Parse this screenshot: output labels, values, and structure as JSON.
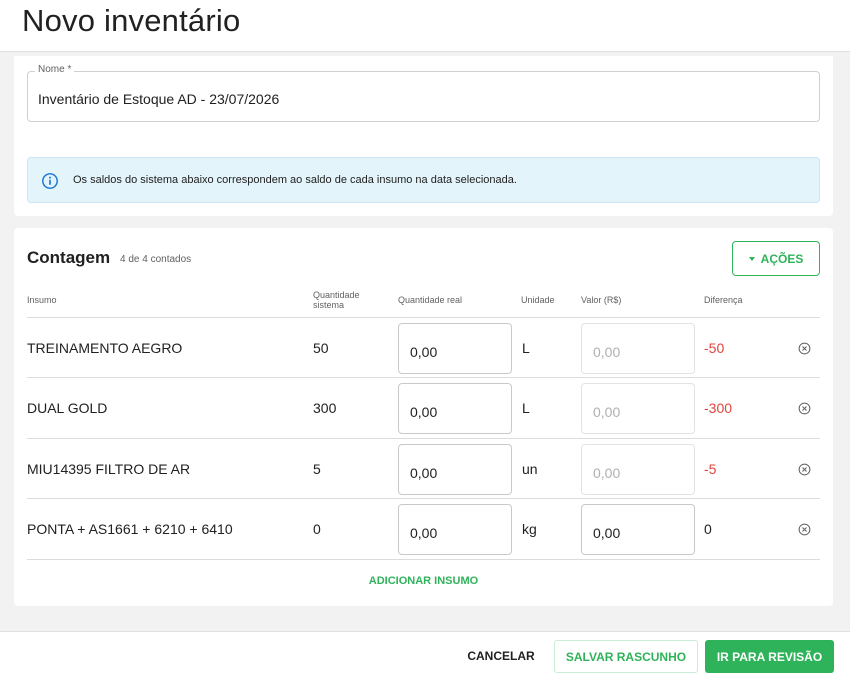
{
  "page": {
    "title": "Novo inventário"
  },
  "name_field": {
    "label": "Nome *",
    "value": "Inventário de Estoque AD - 23/07/2026"
  },
  "info": {
    "icon": "info-icon",
    "text": "Os saldos do sistema abaixo correspondem ao saldo de cada insumo na data selecionada."
  },
  "count": {
    "title": "Contagem",
    "subtitle": "4 de 4 contados",
    "actions_label": "AÇÕES",
    "columns": {
      "insumo": "Insumo",
      "qty_system_1": "Quantidade",
      "qty_system_2": "sistema",
      "qty_real": "Quantidade real",
      "unit": "Unidade",
      "value": "Valor (R$)",
      "diff": "Diferença"
    },
    "rows": [
      {
        "name": "TREINAMENTO AEGRO",
        "qty_system": "50",
        "qty_real": "0,00",
        "unit": "L",
        "value": "0,00",
        "value_enabled": false,
        "diff": "-50"
      },
      {
        "name": "DUAL GOLD",
        "qty_system": "300",
        "qty_real": "0,00",
        "unit": "L",
        "value": "0,00",
        "value_enabled": false,
        "diff": "-300"
      },
      {
        "name": "MIU14395 FILTRO DE AR",
        "qty_system": "5",
        "qty_real": "0,00",
        "unit": "un",
        "value": "0,00",
        "value_enabled": false,
        "diff": "-5"
      },
      {
        "name": "PONTA + AS1661 + 6210 + 6410",
        "qty_system": "0",
        "qty_real": "0,00",
        "unit": "kg",
        "value": "0,00",
        "value_enabled": true,
        "diff": "0"
      }
    ],
    "add_label": "ADICIONAR INSUMO"
  },
  "footer": {
    "cancel_label": "CANCELAR",
    "draft_label": "SALVAR RASCUNHO",
    "review_label": "IR PARA REVISÃO"
  },
  "colors": {
    "accent": "#2fb35a",
    "negative": "#e0463d",
    "info_bg": "#e3f4fb",
    "info_icon": "#1976d2"
  }
}
